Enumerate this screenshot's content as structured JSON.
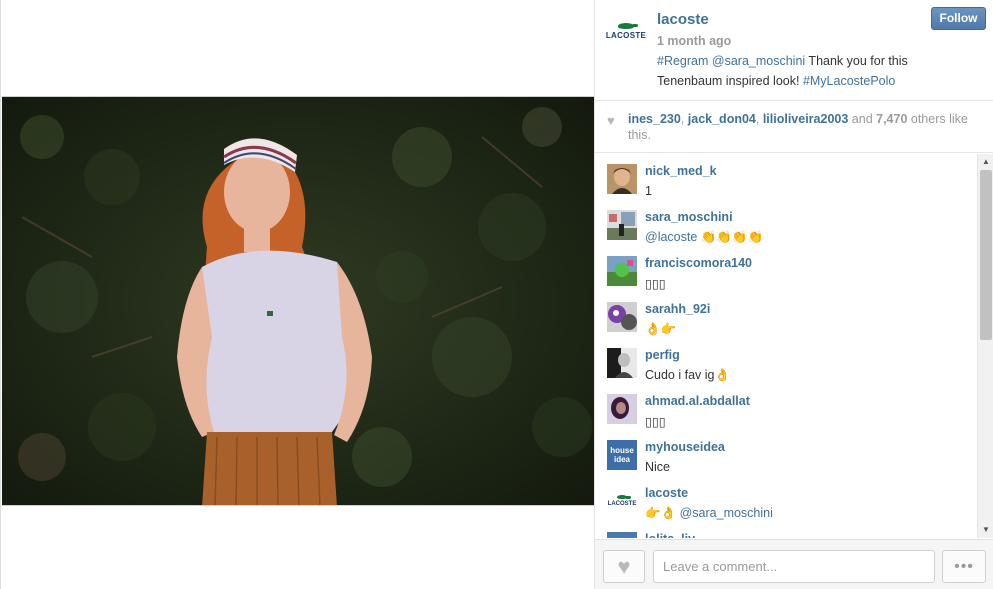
{
  "post": {
    "owner": {
      "username": "lacoste",
      "avatar_text": "LACOSTE",
      "time": "1 month ago",
      "follow_label": "Follow"
    },
    "caption": {
      "hashtag_regram": "#Regram",
      "mention": "@sara_moschini",
      "text": " Thank you for this Tenenbaum inspired look! ",
      "hashtag": "#MyLacostePolo"
    },
    "likes": {
      "users": [
        "ines_230",
        "jack_don04",
        "lilioliveira2003"
      ],
      "sep1": ", ",
      "sep2": ", ",
      "and": " and ",
      "count": "7,470",
      "others": " others like this."
    }
  },
  "comments": [
    {
      "user": "nick_med_k",
      "text": "1"
    },
    {
      "user": "sara_moschini",
      "text": "@lacoste",
      "suffix": " 👏👏👏👏"
    },
    {
      "user": "franciscomora140",
      "text": "▯▯▯"
    },
    {
      "user": "sarahh_92i",
      "text": "👌👉"
    },
    {
      "user": "perfig",
      "text": "Cudo i fav ig👌"
    },
    {
      "user": "ahmad.al.abdallat",
      "text": "▯▯▯"
    },
    {
      "user": "myhouseidea",
      "text": "Nice",
      "avatar_text": "house idea"
    },
    {
      "user": "lacoste",
      "prefix": "👉👌 ",
      "text": "@sara_moschini",
      "avatar_text": "LACOSTE"
    },
    {
      "user": "lolita_liv",
      "text": ""
    }
  ],
  "comment_form": {
    "placeholder": "Leave a comment...",
    "more_label": "•••"
  },
  "colors": {
    "link": "#3f729b",
    "follow_button": "#5a84b1",
    "muted": "#9a9a9a"
  }
}
